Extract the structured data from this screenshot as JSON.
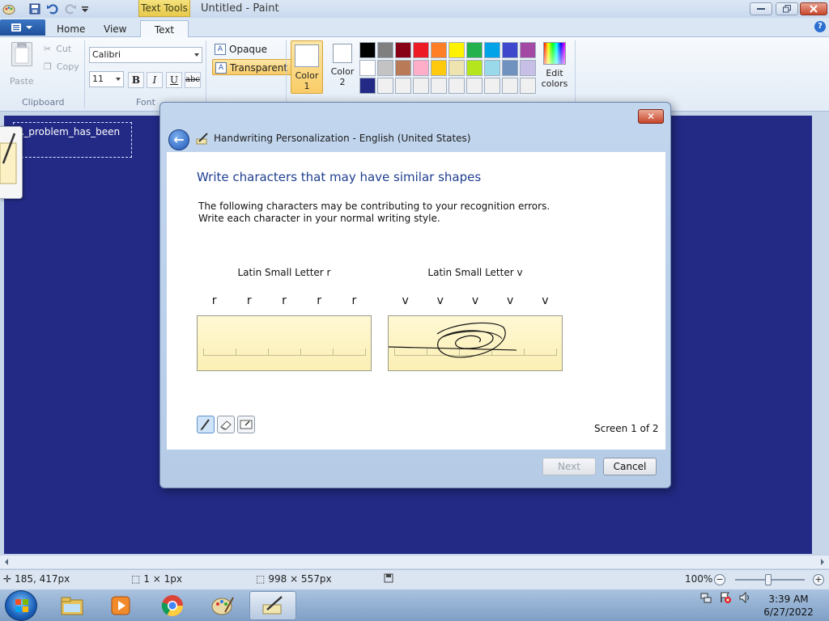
{
  "titlebar": {
    "tools_tab_label": "Text Tools",
    "app_title": "Untitled - Paint",
    "quick_access": [
      "paint-icon",
      "save-icon",
      "undo-icon",
      "redo-icon",
      "customize-dropdown-icon"
    ]
  },
  "tabs": {
    "home": "Home",
    "view": "View",
    "text": "Text",
    "active": "Text"
  },
  "ribbon": {
    "clipboard": {
      "group_label": "Clipboard",
      "paste_label": "Paste",
      "cut_label": "Cut",
      "copy_label": "Copy"
    },
    "font": {
      "group_label": "Font",
      "font_name": "Calibri",
      "font_size": "11",
      "bold": "B",
      "italic": "I",
      "underline": "U",
      "strikethrough": "abc"
    },
    "background": {
      "opaque_label": "Opaque",
      "transparent_label": "Transparent",
      "selected": "Transparent"
    },
    "colors": {
      "color1_label_line1": "Color",
      "color1_label_line2": "1",
      "color2_label_line1": "Color",
      "color2_label_line2": "2",
      "color1_value": "#ffffff",
      "color2_value": "#ffffff",
      "palette": [
        "#000000",
        "#7f7f7f",
        "#880015",
        "#ed1c24",
        "#ff7f27",
        "#fff200",
        "#22b14c",
        "#00a2e8",
        "#3f48cc",
        "#a349a4",
        "#ffffff",
        "#c3c3c3",
        "#b97a57",
        "#ffaec9",
        "#ffc90e",
        "#efe4b0",
        "#b5e61d",
        "#99d9ea",
        "#7092be",
        "#c8bfe7",
        "#232a86",
        "#f0f0f0",
        "#f0f0f0",
        "#f0f0f0",
        "#f0f0f0",
        "#f0f0f0",
        "#f0f0f0",
        "#f0f0f0",
        "#f0f0f0",
        "#f0f0f0"
      ],
      "edit_colors_line1": "Edit",
      "edit_colors_line2": "colors"
    }
  },
  "canvas": {
    "background_color": "#232a86",
    "textbox_line1": "A_problem_has_been",
    "textbox_line2": "_"
  },
  "dialog": {
    "title": "Handwriting Personalization - English (United States)",
    "heading": "Write characters that may have similar shapes",
    "desc_line1": "The following characters may be contributing to your recognition errors.",
    "desc_line2": "Write each character in your normal writing style.",
    "groups": [
      {
        "caption": "Latin Small Letter r",
        "chars": [
          "r",
          "r",
          "r",
          "r",
          "r"
        ]
      },
      {
        "caption": "Latin Small Letter v",
        "chars": [
          "v",
          "v",
          "v",
          "v",
          "v"
        ]
      }
    ],
    "tools": [
      "pen-icon",
      "eraser-icon",
      "clear-icon"
    ],
    "screen_indicator": "Screen 1 of 2",
    "next_label": "Next",
    "cancel_label": "Cancel",
    "close_glyph": "✕"
  },
  "statusbar": {
    "cursor_pos": "185, 417px",
    "selection_size": "1 × 1px",
    "image_size": "998 × 557px",
    "zoom": "100%",
    "zoom_minus": "−",
    "zoom_plus": "+"
  },
  "taskbar": {
    "apps": [
      "explorer-icon",
      "media-player-icon",
      "chrome-icon",
      "paint-icon",
      "handwriting-icon"
    ],
    "active_app": "handwriting-icon",
    "tray_icons": [
      "network-icon",
      "action-center-icon",
      "volume-icon"
    ],
    "time": "3:39 AM",
    "date": "6/27/2022"
  }
}
